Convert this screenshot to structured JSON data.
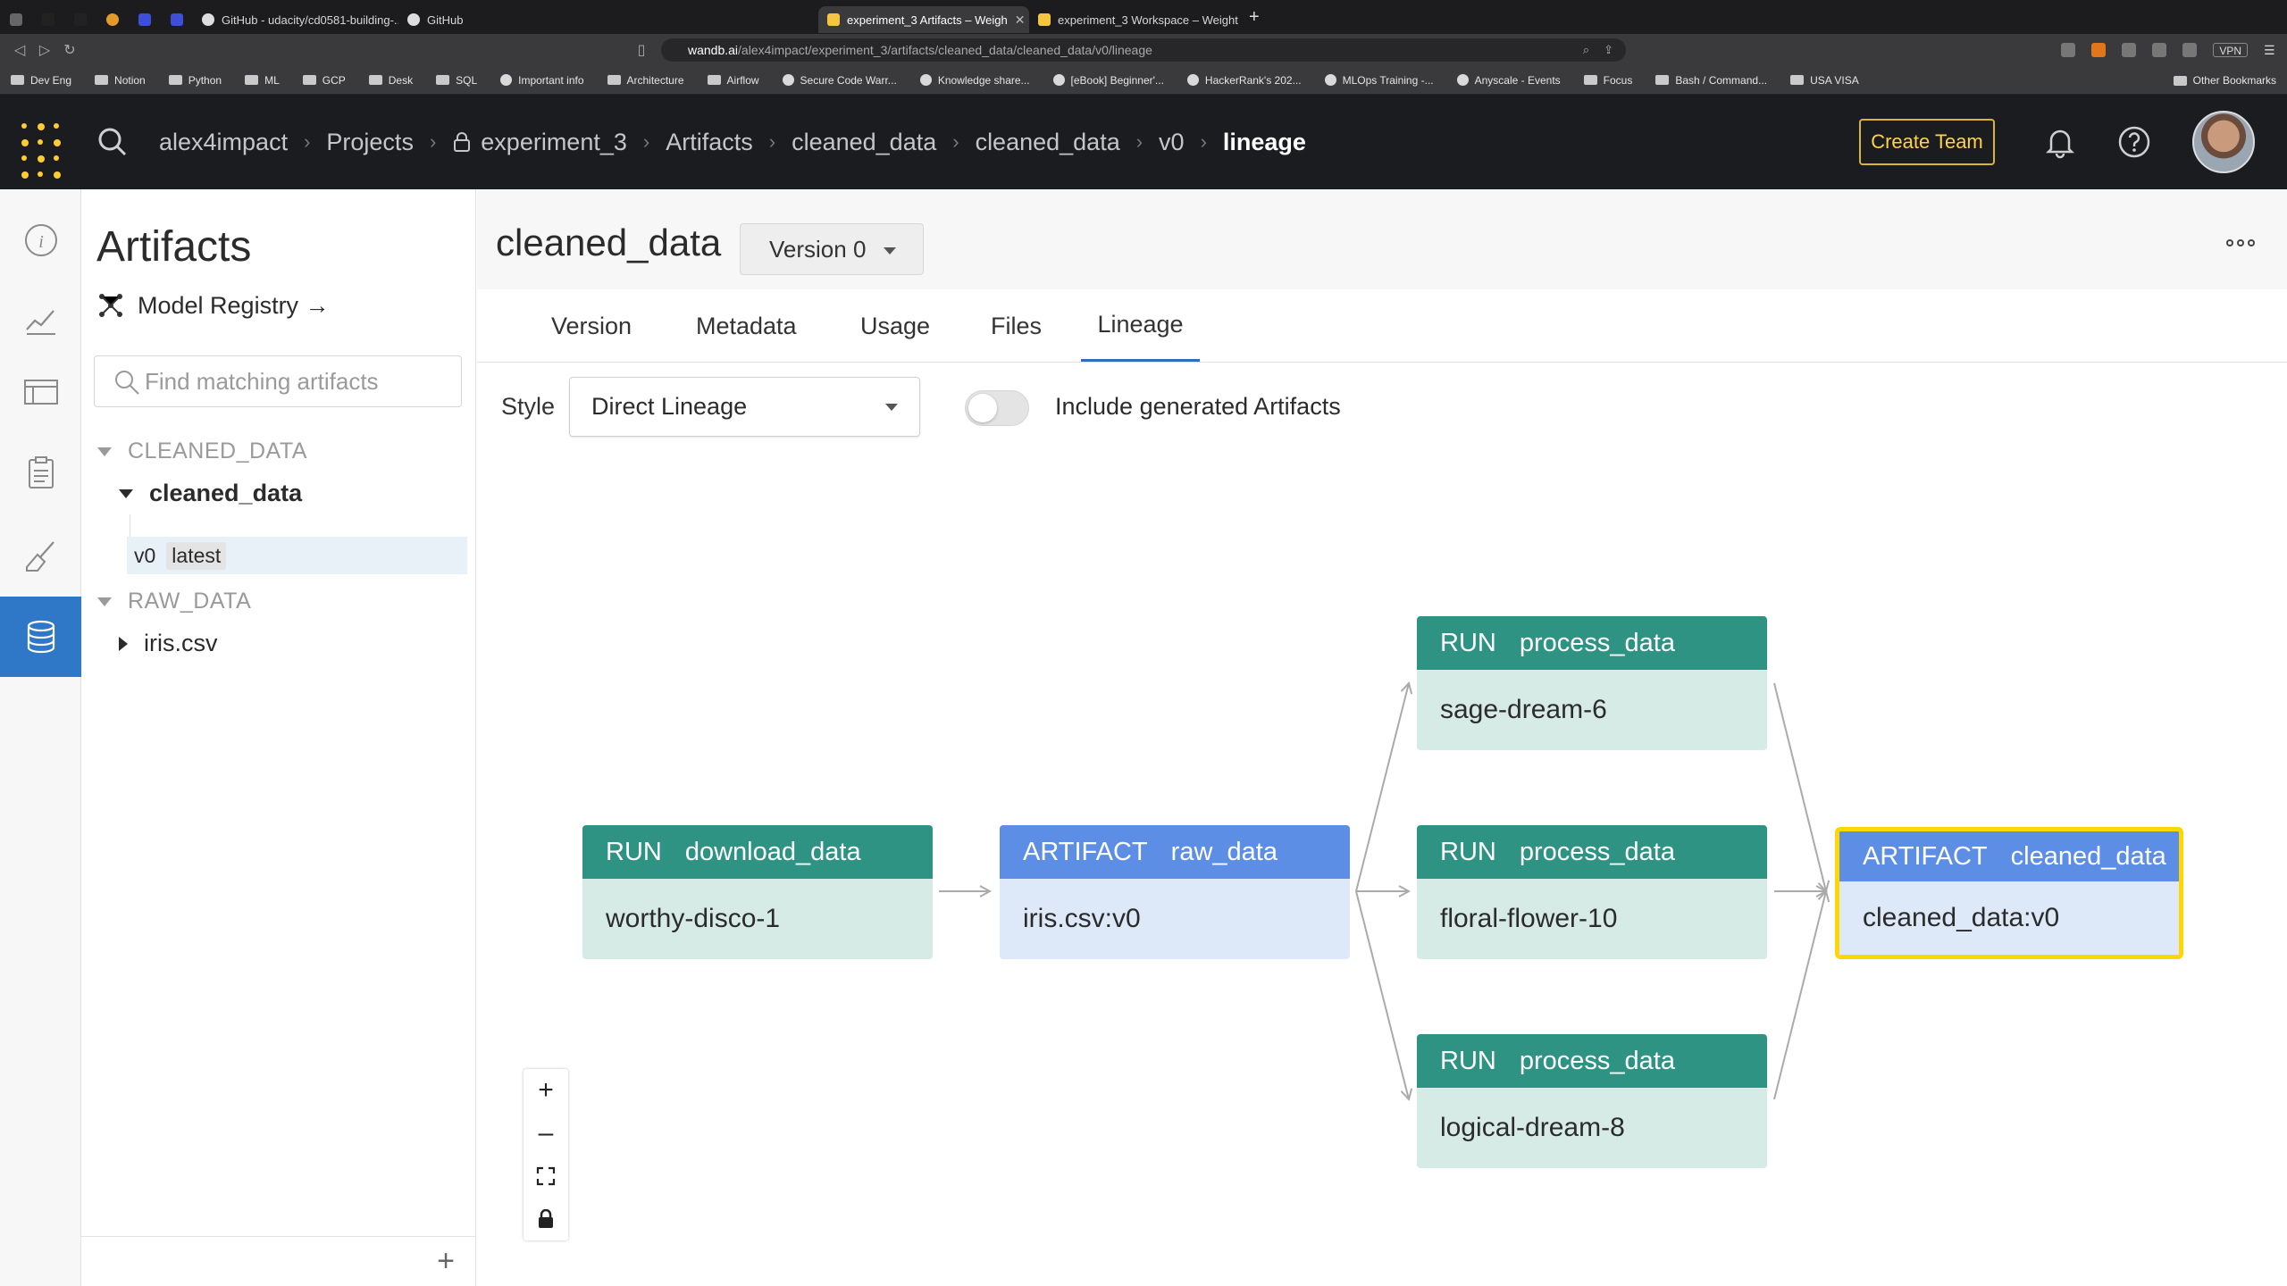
{
  "browser": {
    "tabs": [
      {
        "label": "GitHub - udacity/cd0581-building-..."
      },
      {
        "label": "GitHub"
      },
      {
        "label": "experiment_3 Artifacts – Weigh"
      },
      {
        "label": "experiment_3 Workspace – Weight"
      }
    ],
    "url_host": "wandb.ai",
    "url_path": "/alex4impact/experiment_3/artifacts/cleaned_data/cleaned_data/v0/lineage",
    "vpn": "VPN",
    "bookmarks": [
      "Dev Eng",
      "Notion",
      "Python",
      "ML",
      "GCP",
      "Desk",
      "SQL",
      "Important info",
      "Architecture",
      "Airflow",
      "Secure Code Warr...",
      "Knowledge share...",
      "[eBook] Beginner'...",
      "HackerRank's 202...",
      "MLOps Training -...",
      "Anyscale - Events",
      "Focus",
      "Bash / Command...",
      "USA VISA"
    ],
    "other_bookmarks": "Other Bookmarks"
  },
  "header": {
    "breadcrumbs": [
      "alex4impact",
      "Projects",
      "experiment_3",
      "Artifacts",
      "cleaned_data",
      "cleaned_data",
      "v0",
      "lineage"
    ],
    "create_team": "Create Team"
  },
  "sidebar": {
    "title": "Artifacts",
    "model_registry": "Model Registry →",
    "search_placeholder": "Find matching artifacts",
    "groups": [
      {
        "name": "CLEANED_DATA",
        "collection": "cleaned_data",
        "version": "v0",
        "alias": "latest"
      },
      {
        "name": "RAW_DATA",
        "collection": "iris.csv"
      }
    ]
  },
  "main": {
    "title": "cleaned_data",
    "version_select": "Version 0",
    "tabs": [
      "Version",
      "Metadata",
      "Usage",
      "Files",
      "Lineage"
    ],
    "active_tab": "Lineage",
    "style_label": "Style",
    "style_value": "Direct Lineage",
    "toggle_label": "Include generated Artifacts",
    "toggle_on": false
  },
  "lineage": {
    "nodes": [
      {
        "kind": "RUN",
        "type": "download_data",
        "name": "worthy-disco-1"
      },
      {
        "kind": "ARTIFACT",
        "type": "raw_data",
        "name": "iris.csv:v0"
      },
      {
        "kind": "RUN",
        "type": "process_data",
        "name": "sage-dream-6"
      },
      {
        "kind": "RUN",
        "type": "process_data",
        "name": "floral-flower-10"
      },
      {
        "kind": "RUN",
        "type": "process_data",
        "name": "logical-dream-8"
      },
      {
        "kind": "ARTIFACT",
        "type": "cleaned_data",
        "name": "cleaned_data:v0"
      }
    ]
  },
  "colors": {
    "run_header": "#2f9384",
    "artifact_header": "#5d8ee6",
    "selected_border": "#ffd700",
    "brand_yellow": "#ffcc33",
    "rail_active": "#2e78c7"
  }
}
